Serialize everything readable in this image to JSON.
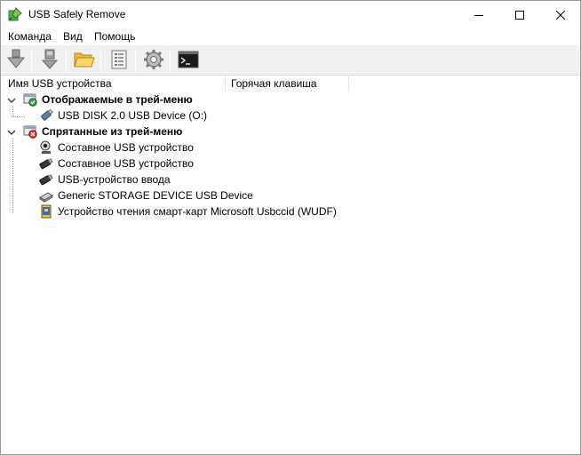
{
  "window": {
    "title": "USB Safely Remove"
  },
  "menu": [
    {
      "label": "Команда"
    },
    {
      "label": "Вид"
    },
    {
      "label": "Помощь"
    }
  ],
  "toolbar": {
    "buttons": [
      {
        "icon": "eject-arrow-icon"
      },
      {
        "icon": "stop-device-icon"
      },
      {
        "icon": "folder-open-icon"
      },
      {
        "icon": "properties-icon"
      },
      {
        "icon": "gear-icon"
      },
      {
        "icon": "command-line-icon"
      }
    ]
  },
  "columns": {
    "name": "Имя USB устройства",
    "hotkey": "Горячая клавиша"
  },
  "groups": [
    {
      "label": "Отображаемые в трей-меню",
      "icon": "tray-visible-icon",
      "items": [
        {
          "label": "USB DISK 2.0 USB Device (O:)",
          "icon": "usb-stick-icon"
        }
      ]
    },
    {
      "label": "Спрятанные из трей-меню",
      "icon": "tray-hidden-icon",
      "items": [
        {
          "label": "Составное USB устройство",
          "icon": "webcam-icon"
        },
        {
          "label": "Составное USB устройство",
          "icon": "usb-plug-icon"
        },
        {
          "label": "USB-устройство ввода",
          "icon": "usb-plug-icon"
        },
        {
          "label": "Generic STORAGE DEVICE USB Device",
          "icon": "card-reader-icon"
        },
        {
          "label": "Устройство чтения смарт-карт Microsoft Usbccid (WUDF)",
          "icon": "smart-card-reader-icon"
        }
      ]
    }
  ]
}
